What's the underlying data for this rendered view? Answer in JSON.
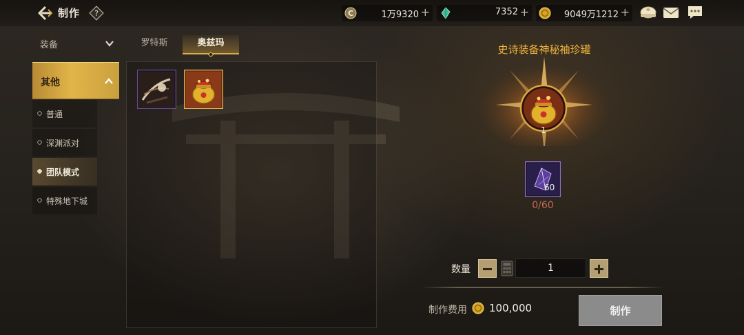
{
  "header": {
    "title": "制作",
    "help": "?",
    "currencies": [
      {
        "icon": "gold-c-coin-icon",
        "value": "1万9320",
        "plus": "+"
      },
      {
        "icon": "green-crystal-icon",
        "value": "7352",
        "plus": "+"
      },
      {
        "icon": "gold-coin-icon",
        "value": "9049万1212",
        "plus": "+"
      }
    ],
    "icons": [
      "bun-icon",
      "mail-icon",
      "chat-icon"
    ]
  },
  "sidebar": {
    "category": "装备",
    "group": "其他",
    "items": [
      {
        "label": "普通",
        "active": false
      },
      {
        "label": "深渊派对",
        "active": false
      },
      {
        "label": "团队模式",
        "active": true
      },
      {
        "label": "特殊地下城",
        "active": false
      }
    ]
  },
  "tabs": [
    {
      "label": "罗特斯",
      "active": false
    },
    {
      "label": "奥兹玛",
      "active": true
    }
  ],
  "items": [
    {
      "icon": "spiral-relic-icon",
      "selected": false
    },
    {
      "icon": "treasure-pot-icon",
      "selected": true
    }
  ],
  "detail": {
    "title": "史诗装备神秘袖珍罐",
    "product_icon": "treasure-pot-icon",
    "product_count": "1",
    "material": {
      "icon": "purple-crystal-icon",
      "count": "60",
      "progress": "0/60"
    },
    "quantity_label": "数量",
    "quantity": "1",
    "cost_label": "制作费用",
    "cost_value": "100,000",
    "craft_label": "制作"
  },
  "colors": {
    "accent": "#e2b548",
    "title": "#f0b43a",
    "progress_insufficient": "#c46a57",
    "craft_disabled": "#8b8b8b"
  }
}
